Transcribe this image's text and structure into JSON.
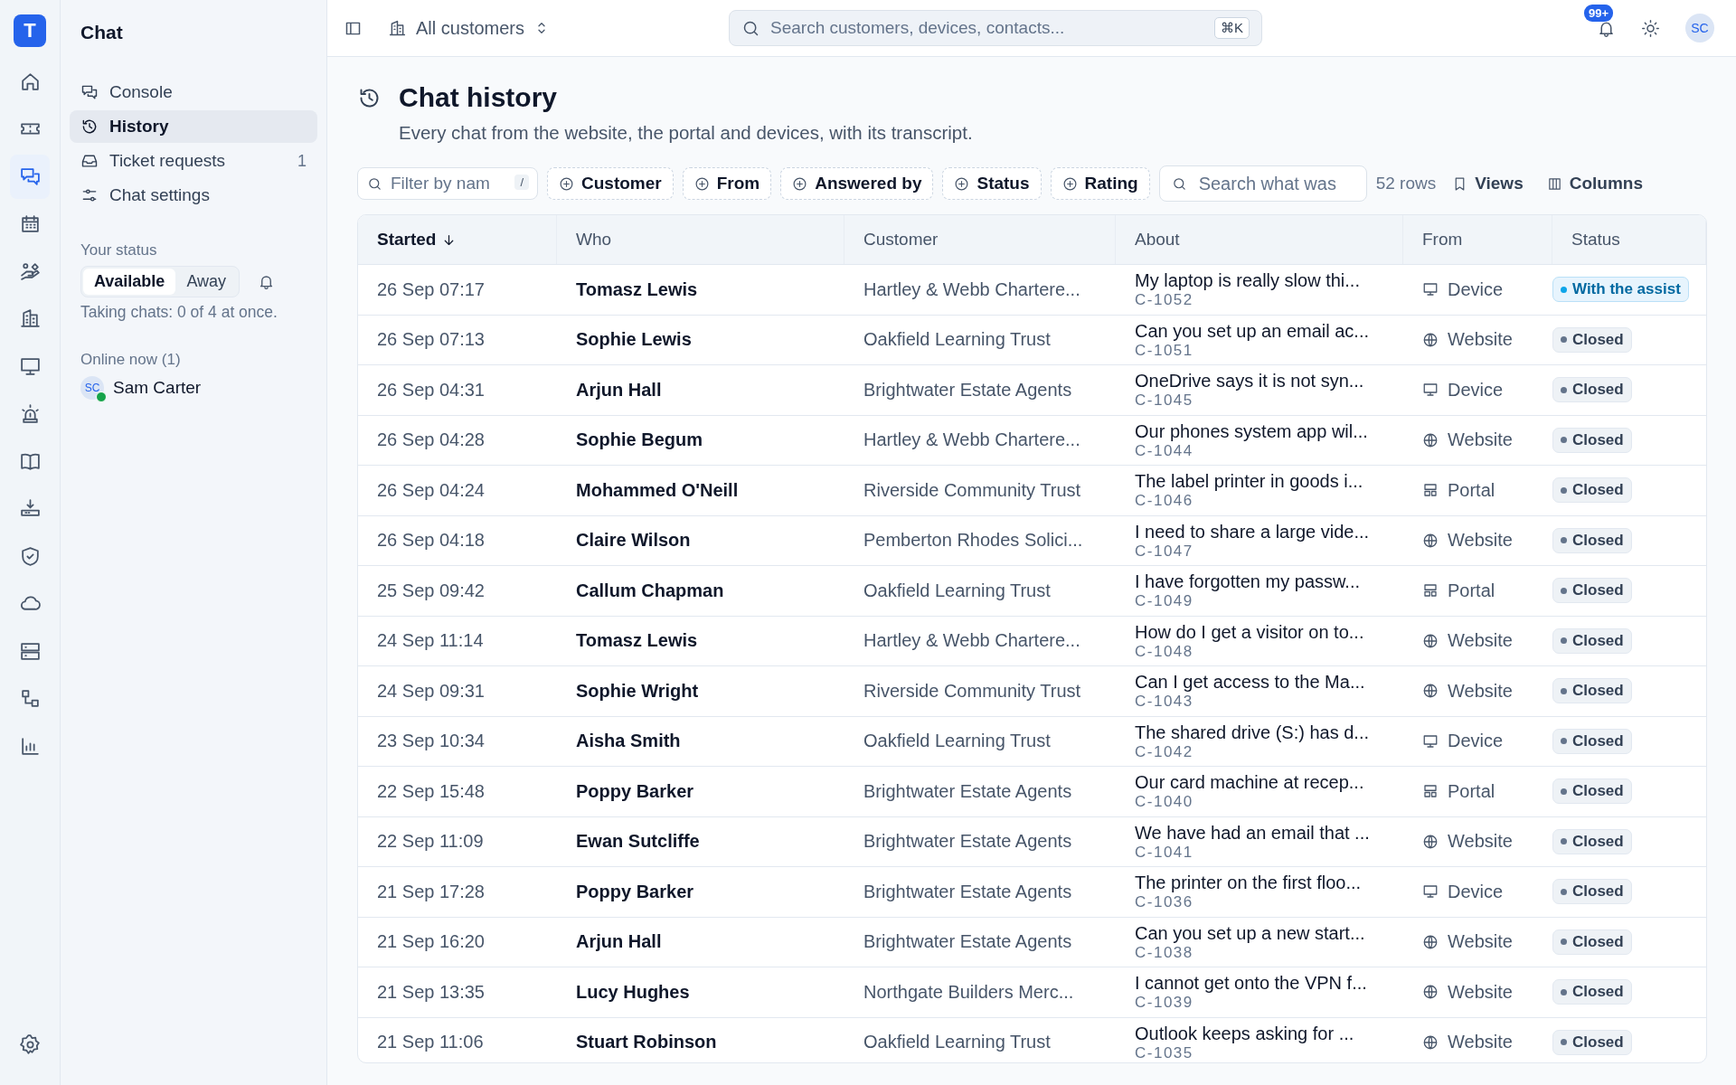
{
  "rail": {
    "logo": "T",
    "items": [
      {
        "kind": "home",
        "selected": false
      },
      {
        "kind": "ticket",
        "selected": false
      },
      {
        "kind": "chat",
        "selected": true
      },
      {
        "kind": "calendar",
        "selected": false
      },
      {
        "kind": "care",
        "selected": false
      },
      {
        "kind": "building",
        "selected": false
      },
      {
        "kind": "monitor",
        "selected": false
      },
      {
        "kind": "alarm",
        "selected": false
      },
      {
        "kind": "book",
        "selected": false
      },
      {
        "kind": "tray",
        "selected": false
      },
      {
        "kind": "shield",
        "selected": false
      },
      {
        "kind": "cloud",
        "selected": false
      },
      {
        "kind": "server",
        "selected": false
      },
      {
        "kind": "workflow",
        "selected": false
      },
      {
        "kind": "chart",
        "selected": false
      }
    ],
    "bottom": [
      {
        "kind": "settings",
        "selected": false
      }
    ]
  },
  "sidebar": {
    "title": "Chat",
    "items": [
      {
        "kind": "console",
        "label": "Console",
        "selected": false
      },
      {
        "kind": "history",
        "label": "History",
        "selected": true
      },
      {
        "kind": "inbox",
        "label": "Ticket requests",
        "count": "1",
        "selected": false
      },
      {
        "kind": "sliders",
        "label": "Chat settings",
        "selected": false
      }
    ],
    "status_label": "Your status",
    "status_options": [
      {
        "label": "Available",
        "selected": true
      },
      {
        "label": "Away",
        "selected": false
      }
    ],
    "status_note": "Taking chats: 0 of 4 at once.",
    "online_label": "Online now (1)",
    "online": [
      {
        "initials": "SC",
        "name": "Sam Carter",
        "online": true
      }
    ]
  },
  "topbar": {
    "scope": "All customers",
    "search_placeholder": "Search customers, devices, contacts...",
    "shortcut": "⌘K",
    "notifications": "99+",
    "avatar": "SC"
  },
  "header": {
    "title": "Chat history",
    "subtitle": "Every chat from the website, the portal and devices, with its transcript."
  },
  "filters": {
    "filter_placeholder": "Filter by nam",
    "filter_key": "/",
    "chips": [
      "Customer",
      "From",
      "Answered by",
      "Status",
      "Rating"
    ],
    "search_placeholder": "Search what was",
    "row_count": "52 rows",
    "views": "Views",
    "columns": "Columns"
  },
  "table": {
    "columns": [
      {
        "label": "Started",
        "sorted": true
      },
      {
        "label": "Who",
        "sorted": false
      },
      {
        "label": "Customer",
        "sorted": false
      },
      {
        "label": "About",
        "sorted": false
      },
      {
        "label": "From",
        "sorted": false
      },
      {
        "label": "Status",
        "sorted": false
      }
    ],
    "rows": [
      {
        "started": "26 Sep 07:17",
        "who": "Tomasz Lewis",
        "customer": "Hartley & Webb Chartere...",
        "about": "My laptop is really slow thi...",
        "id": "C-1052",
        "from": {
          "kind": "device",
          "label": "Device"
        },
        "status": {
          "kind": "active",
          "label": "With the assist"
        }
      },
      {
        "started": "26 Sep 07:13",
        "who": "Sophie Lewis",
        "customer": "Oakfield Learning Trust",
        "about": "Can you set up an email ac...",
        "id": "C-1051",
        "from": {
          "kind": "website",
          "label": "Website"
        },
        "status": {
          "kind": "closed",
          "label": "Closed"
        }
      },
      {
        "started": "26 Sep 04:31",
        "who": "Arjun Hall",
        "customer": "Brightwater Estate Agents",
        "about": "OneDrive says it is not syn...",
        "id": "C-1045",
        "from": {
          "kind": "device",
          "label": "Device"
        },
        "status": {
          "kind": "closed",
          "label": "Closed"
        }
      },
      {
        "started": "26 Sep 04:28",
        "who": "Sophie Begum",
        "customer": "Hartley & Webb Chartere...",
        "about": "Our phones system app wil...",
        "id": "C-1044",
        "from": {
          "kind": "website",
          "label": "Website"
        },
        "status": {
          "kind": "closed",
          "label": "Closed"
        }
      },
      {
        "started": "26 Sep 04:24",
        "who": "Mohammed O'Neill",
        "customer": "Riverside Community Trust",
        "about": "The label printer in goods i...",
        "id": "C-1046",
        "from": {
          "kind": "portal",
          "label": "Portal"
        },
        "status": {
          "kind": "closed",
          "label": "Closed"
        }
      },
      {
        "started": "26 Sep 04:18",
        "who": "Claire Wilson",
        "customer": "Pemberton Rhodes Solici...",
        "about": "I need to share a large vide...",
        "id": "C-1047",
        "from": {
          "kind": "website",
          "label": "Website"
        },
        "status": {
          "kind": "closed",
          "label": "Closed"
        }
      },
      {
        "started": "25 Sep 09:42",
        "who": "Callum Chapman",
        "customer": "Oakfield Learning Trust",
        "about": "I have forgotten my passw...",
        "id": "C-1049",
        "from": {
          "kind": "portal",
          "label": "Portal"
        },
        "status": {
          "kind": "closed",
          "label": "Closed"
        }
      },
      {
        "started": "24 Sep 11:14",
        "who": "Tomasz Lewis",
        "customer": "Hartley & Webb Chartere...",
        "about": "How do I get a visitor on to...",
        "id": "C-1048",
        "from": {
          "kind": "website",
          "label": "Website"
        },
        "status": {
          "kind": "closed",
          "label": "Closed"
        }
      },
      {
        "started": "24 Sep 09:31",
        "who": "Sophie Wright",
        "customer": "Riverside Community Trust",
        "about": "Can I get access to the Ma...",
        "id": "C-1043",
        "from": {
          "kind": "website",
          "label": "Website"
        },
        "status": {
          "kind": "closed",
          "label": "Closed"
        }
      },
      {
        "started": "23 Sep 10:34",
        "who": "Aisha Smith",
        "customer": "Oakfield Learning Trust",
        "about": "The shared drive (S:) has d...",
        "id": "C-1042",
        "from": {
          "kind": "device",
          "label": "Device"
        },
        "status": {
          "kind": "closed",
          "label": "Closed"
        }
      },
      {
        "started": "22 Sep 15:48",
        "who": "Poppy Barker",
        "customer": "Brightwater Estate Agents",
        "about": "Our card machine at recep...",
        "id": "C-1040",
        "from": {
          "kind": "portal",
          "label": "Portal"
        },
        "status": {
          "kind": "closed",
          "label": "Closed"
        }
      },
      {
        "started": "22 Sep 11:09",
        "who": "Ewan Sutcliffe",
        "customer": "Brightwater Estate Agents",
        "about": "We have had an email that ...",
        "id": "C-1041",
        "from": {
          "kind": "website",
          "label": "Website"
        },
        "status": {
          "kind": "closed",
          "label": "Closed"
        }
      },
      {
        "started": "21 Sep 17:28",
        "who": "Poppy Barker",
        "customer": "Brightwater Estate Agents",
        "about": "The printer on the first floo...",
        "id": "C-1036",
        "from": {
          "kind": "device",
          "label": "Device"
        },
        "status": {
          "kind": "closed",
          "label": "Closed"
        }
      },
      {
        "started": "21 Sep 16:20",
        "who": "Arjun Hall",
        "customer": "Brightwater Estate Agents",
        "about": "Can you set up a new start...",
        "id": "C-1038",
        "from": {
          "kind": "website",
          "label": "Website"
        },
        "status": {
          "kind": "closed",
          "label": "Closed"
        }
      },
      {
        "started": "21 Sep 13:35",
        "who": "Lucy Hughes",
        "customer": "Northgate Builders Merc...",
        "about": "I cannot get onto the VPN f...",
        "id": "C-1039",
        "from": {
          "kind": "website",
          "label": "Website"
        },
        "status": {
          "kind": "closed",
          "label": "Closed"
        }
      },
      {
        "started": "21 Sep 11:06",
        "who": "Stuart Robinson",
        "customer": "Oakfield Learning Trust",
        "about": "Outlook keeps asking for ...",
        "id": "C-1035",
        "from": {
          "kind": "website",
          "label": "Website"
        },
        "status": {
          "kind": "closed",
          "label": "Closed"
        }
      }
    ]
  }
}
